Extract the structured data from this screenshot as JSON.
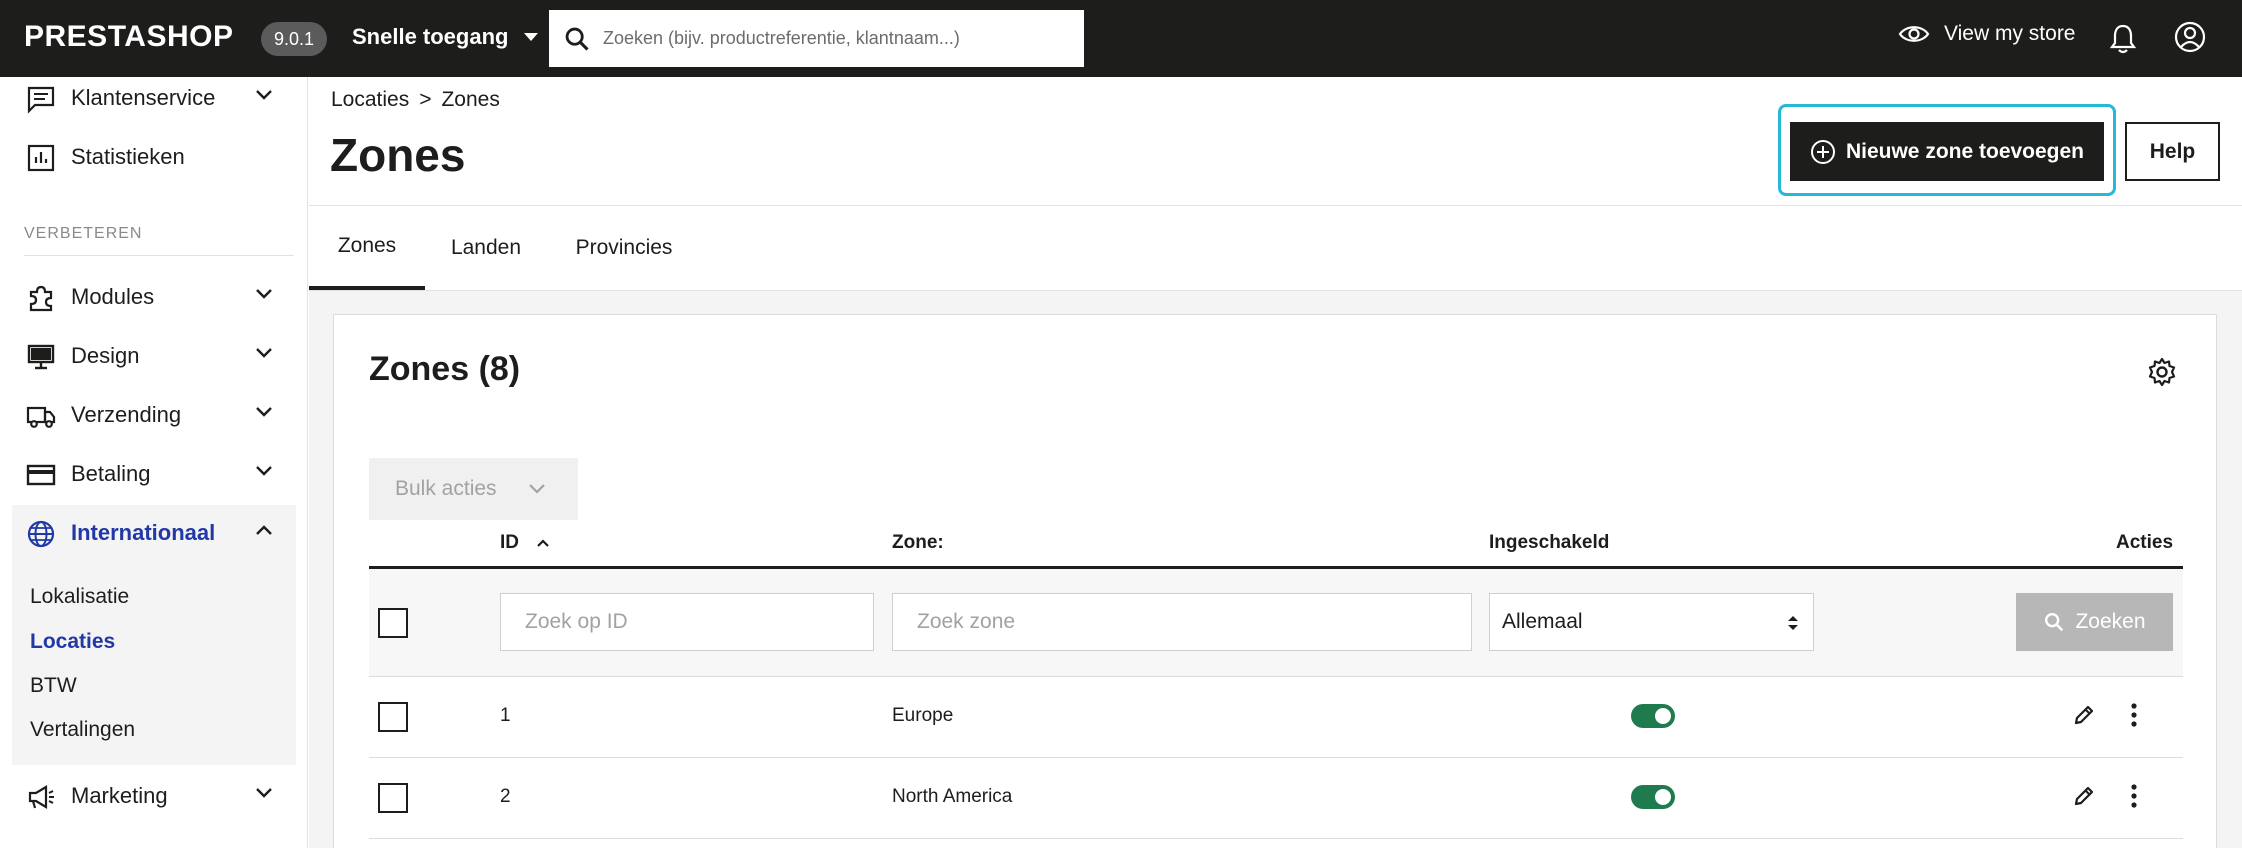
{
  "topbar": {
    "logo": "PRESTASHOP",
    "version": "9.0.1",
    "quick_access": "Snelle toegang",
    "search_placeholder": "Zoeken (bijv. productreferentie, klantnaam...)",
    "view_store": "View my store"
  },
  "sidebar": {
    "items_top": [
      {
        "label": "Klantenservice",
        "icon": "chat-icon"
      },
      {
        "label": "Statistieken",
        "icon": "chart-icon"
      }
    ],
    "section": "VERBETEREN",
    "items": [
      {
        "label": "Modules",
        "icon": "puzzle-icon"
      },
      {
        "label": "Design",
        "icon": "monitor-icon"
      },
      {
        "label": "Verzending",
        "icon": "truck-icon"
      },
      {
        "label": "Betaling",
        "icon": "card-icon"
      },
      {
        "label": "Internationaal",
        "icon": "globe-icon"
      }
    ],
    "sub_items": [
      "Lokalisatie",
      "Locaties",
      "BTW",
      "Vertalingen"
    ],
    "bottom": {
      "label": "Marketing",
      "icon": "megaphone-icon"
    }
  },
  "breadcrumb": {
    "parent": "Locaties",
    "separator": ">",
    "current": "Zones"
  },
  "page_title": "Zones",
  "buttons": {
    "add_zone": "Nieuwe zone toevoegen",
    "help": "Help"
  },
  "tabs": [
    "Zones",
    "Landen",
    "Provincies"
  ],
  "card": {
    "title": "Zones (8)",
    "bulk_actions": "Bulk acties",
    "columns": {
      "id": "ID",
      "zone": "Zone:",
      "enabled": "Ingeschakeld",
      "actions": "Acties"
    },
    "filters": {
      "id_placeholder": "Zoek op ID",
      "zone_placeholder": "Zoek zone",
      "enabled_value": "Allemaal",
      "search_label": "Zoeken"
    },
    "rows": [
      {
        "id": "1",
        "zone": "Europe",
        "enabled": true
      },
      {
        "id": "2",
        "zone": "North America",
        "enabled": true
      }
    ]
  },
  "colors": {
    "accent": "#2138a6",
    "highlight": "#25b9d7",
    "toggle_on": "#1f7b4d",
    "dark": "#1d1d1b"
  }
}
